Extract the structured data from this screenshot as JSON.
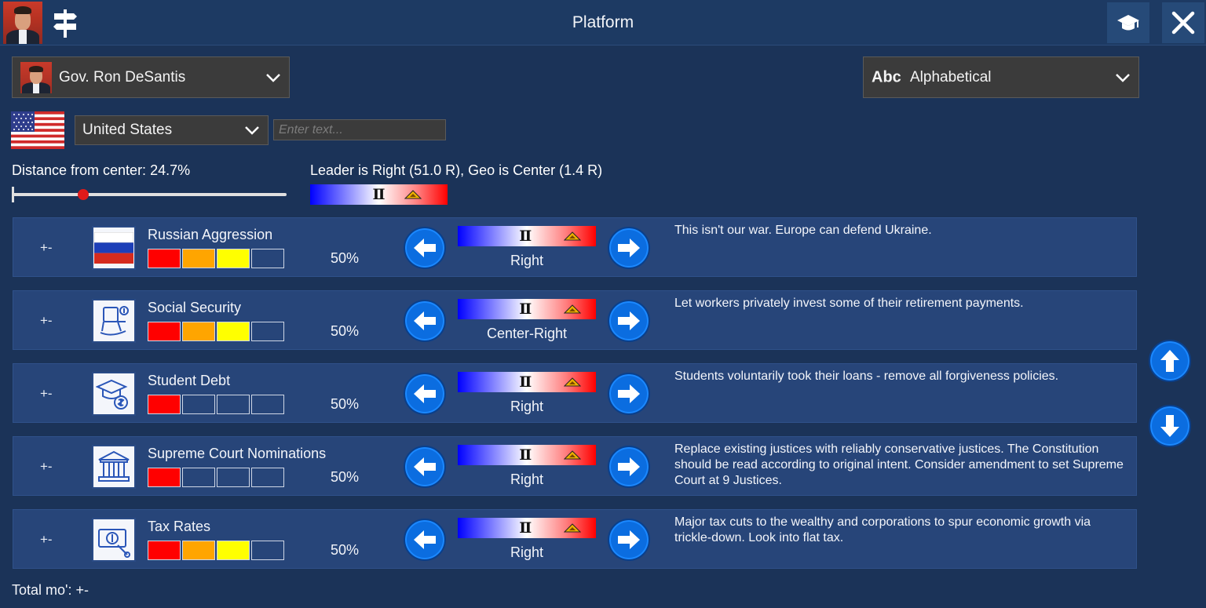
{
  "window": {
    "title": "Platform",
    "icons": [
      "signpost-icon",
      "graduation-cap-icon",
      "close-icon"
    ]
  },
  "candidate_select": {
    "selected": "Gov. Ron DeSantis"
  },
  "sort_select": {
    "icon_text": "Abc",
    "selected": "Alphabetical"
  },
  "country_select": {
    "selected": "United States"
  },
  "search": {
    "placeholder": "Enter text...",
    "value": ""
  },
  "distance": {
    "label": "Distance from  center: 24.7%",
    "slider_fraction": 0.26
  },
  "leader_summary": {
    "text": "Leader is Right (51.0 R), Geo is Center (1.4 R)"
  },
  "colors": {
    "level_red": "#ff0000",
    "level_orange": "#ffa500",
    "level_yellow": "#ffff00",
    "arrow_blue": "#0b6de0",
    "row_bg": "#274579"
  },
  "issues": [
    {
      "plus_minus": "+-",
      "name": "Russian Aggression",
      "icon": "russia-flag-icon",
      "levels": [
        "red",
        "orange",
        "yellow",
        "empty"
      ],
      "percent": "50%",
      "position": "Right",
      "description": "This isn't our war. Europe can defend Ukraine."
    },
    {
      "plus_minus": "+-",
      "name": "Social Security",
      "icon": "rocking-chair-icon",
      "levels": [
        "red",
        "orange",
        "yellow",
        "empty"
      ],
      "percent": "50%",
      "position": "Center-Right",
      "description": "Let workers privately invest some of their retirement payments."
    },
    {
      "plus_minus": "+-",
      "name": "Student Debt",
      "icon": "graduation-money-icon",
      "levels": [
        "red",
        "empty",
        "empty",
        "empty"
      ],
      "percent": "50%",
      "position": "Right",
      "description": "Students voluntarily took their loans - remove all forgiveness policies."
    },
    {
      "plus_minus": "+-",
      "name": "Supreme Court Nominations",
      "icon": "courthouse-icon",
      "levels": [
        "red",
        "empty",
        "empty",
        "empty"
      ],
      "percent": "50%",
      "position": "Right",
      "description": "Replace existing justices with reliably conservative justices. The Constitution should be read according to original intent. Consider amendment to set Supreme Court at 9 Justices."
    },
    {
      "plus_minus": "+-",
      "name": "Tax Rates",
      "icon": "money-tax-icon",
      "levels": [
        "red",
        "orange",
        "yellow",
        "empty"
      ],
      "percent": "50%",
      "position": "Right",
      "description": "Major tax cuts to the wealthy and corporations to spur economic growth via trickle-down. Look into flat tax."
    }
  ],
  "footer": {
    "text": "Total mo': +-"
  }
}
